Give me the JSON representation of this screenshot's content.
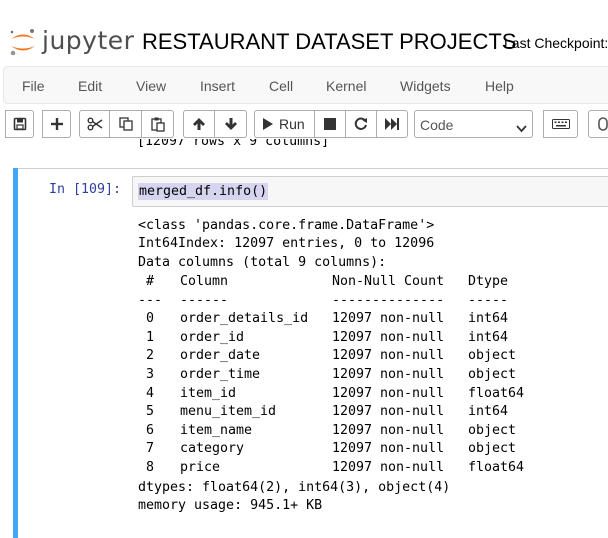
{
  "header": {
    "logo_text": "jupyter",
    "notebook_title": "RESTAURANT DATASET PROJECTS",
    "checkpoint": "Last Checkpoint:"
  },
  "menu": [
    "File",
    "Edit",
    "View",
    "Insert",
    "Cell",
    "Kernel",
    "Widgets",
    "Help"
  ],
  "toolbar": {
    "run_label": "Run",
    "cell_type": "Code",
    "icons": [
      "save-icon",
      "plus-icon",
      "cut-icon",
      "copy-icon",
      "paste-icon",
      "arrow-up-icon",
      "arrow-down-icon",
      "play-icon",
      "stop-icon",
      "restart-icon",
      "fast-forward-icon",
      "keyboard-icon"
    ]
  },
  "notebook": {
    "previous_output": "[12097 rows x 9 columns]",
    "cell": {
      "prompt": "In [109]:",
      "code": "merged_df.info()",
      "output": {
        "class_line": "<class 'pandas.core.frame.DataFrame'>",
        "index_line": "Int64Index: 12097 entries, 0 to 12096",
        "data_columns_line": "Data columns (total 9 columns):",
        "headers": [
          "#",
          "Column",
          "Non-Null Count",
          "Dtype"
        ],
        "separators": [
          "---",
          "------",
          "--------------",
          "-----"
        ],
        "rows": [
          [
            "0",
            "order_details_id",
            "12097 non-null",
            "int64"
          ],
          [
            "1",
            "order_id",
            "12097 non-null",
            "int64"
          ],
          [
            "2",
            "order_date",
            "12097 non-null",
            "object"
          ],
          [
            "3",
            "order_time",
            "12097 non-null",
            "object"
          ],
          [
            "4",
            "item_id",
            "12097 non-null",
            "float64"
          ],
          [
            "5",
            "menu_item_id",
            "12097 non-null",
            "int64"
          ],
          [
            "6",
            "item_name",
            "12097 non-null",
            "object"
          ],
          [
            "7",
            "category",
            "12097 non-null",
            "object"
          ],
          [
            "8",
            "price",
            "12097 non-null",
            "float64"
          ]
        ],
        "dtypes_line": "dtypes: float64(2), int64(3), object(4)",
        "memory_line": "memory usage: 945.1+ KB"
      }
    }
  },
  "colors": {
    "accent_bar": "#42a5f5",
    "prompt": "#303f9f",
    "logo_orange": "#f37726",
    "code_highlight": "#d7d4f0"
  }
}
